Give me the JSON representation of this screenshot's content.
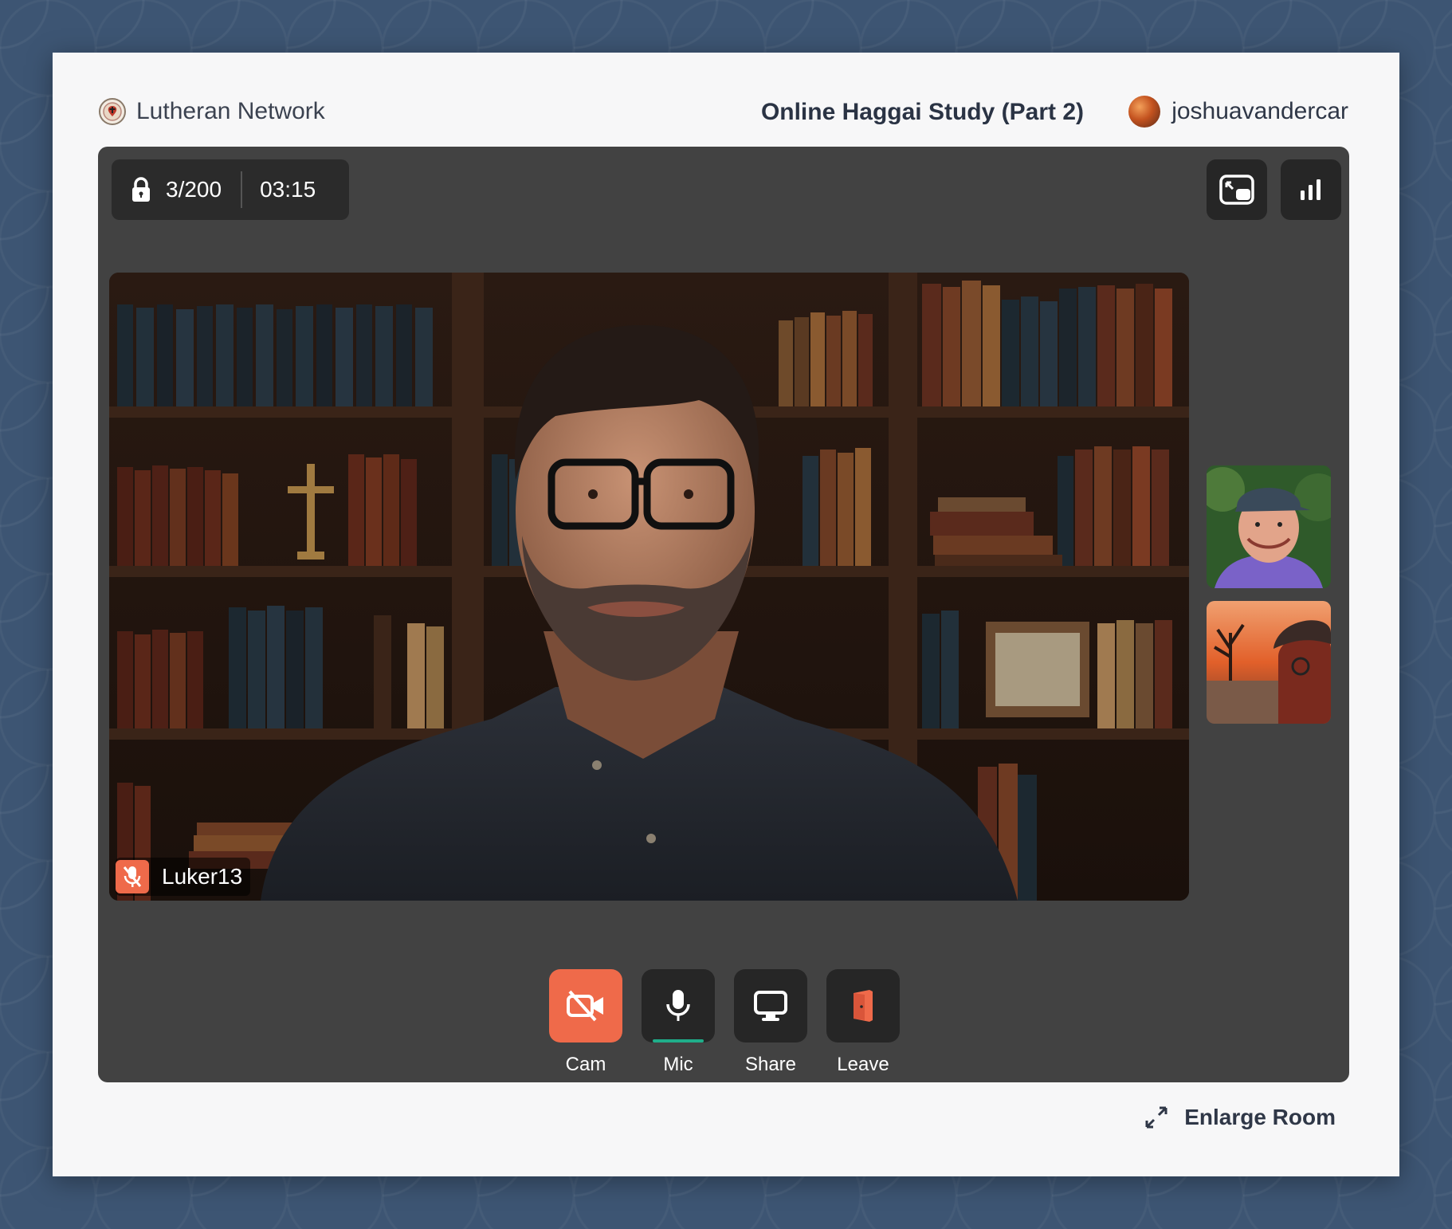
{
  "brand": {
    "name": "Lutheran Network",
    "logo_icon": "luther-rose-icon"
  },
  "meeting": {
    "title": "Online Haggai Study (Part 2)"
  },
  "user": {
    "name": "joshuavandercar"
  },
  "stats": {
    "participants": "3/200",
    "elapsed": "03:15"
  },
  "main_video": {
    "speaker": "Luker13",
    "muted": true
  },
  "thumbnails": [
    {
      "description_icon": "participant-thumbnail"
    },
    {
      "description_icon": "participant-thumbnail"
    }
  ],
  "controls": [
    {
      "label": "Cam",
      "icon": "camera-off-icon",
      "active": true
    },
    {
      "label": "Mic",
      "icon": "microphone-icon",
      "active": false
    },
    {
      "label": "Share",
      "icon": "screen-share-icon",
      "active": false
    },
    {
      "label": "Leave",
      "icon": "door-exit-icon",
      "active": false
    }
  ],
  "footer": {
    "enlarge_label": "Enlarge Room"
  },
  "colors": {
    "accent": "#ef6a4a",
    "mic_level": "#1fae8a",
    "room_bg": "#424242",
    "page_bg": "#3d5573"
  }
}
